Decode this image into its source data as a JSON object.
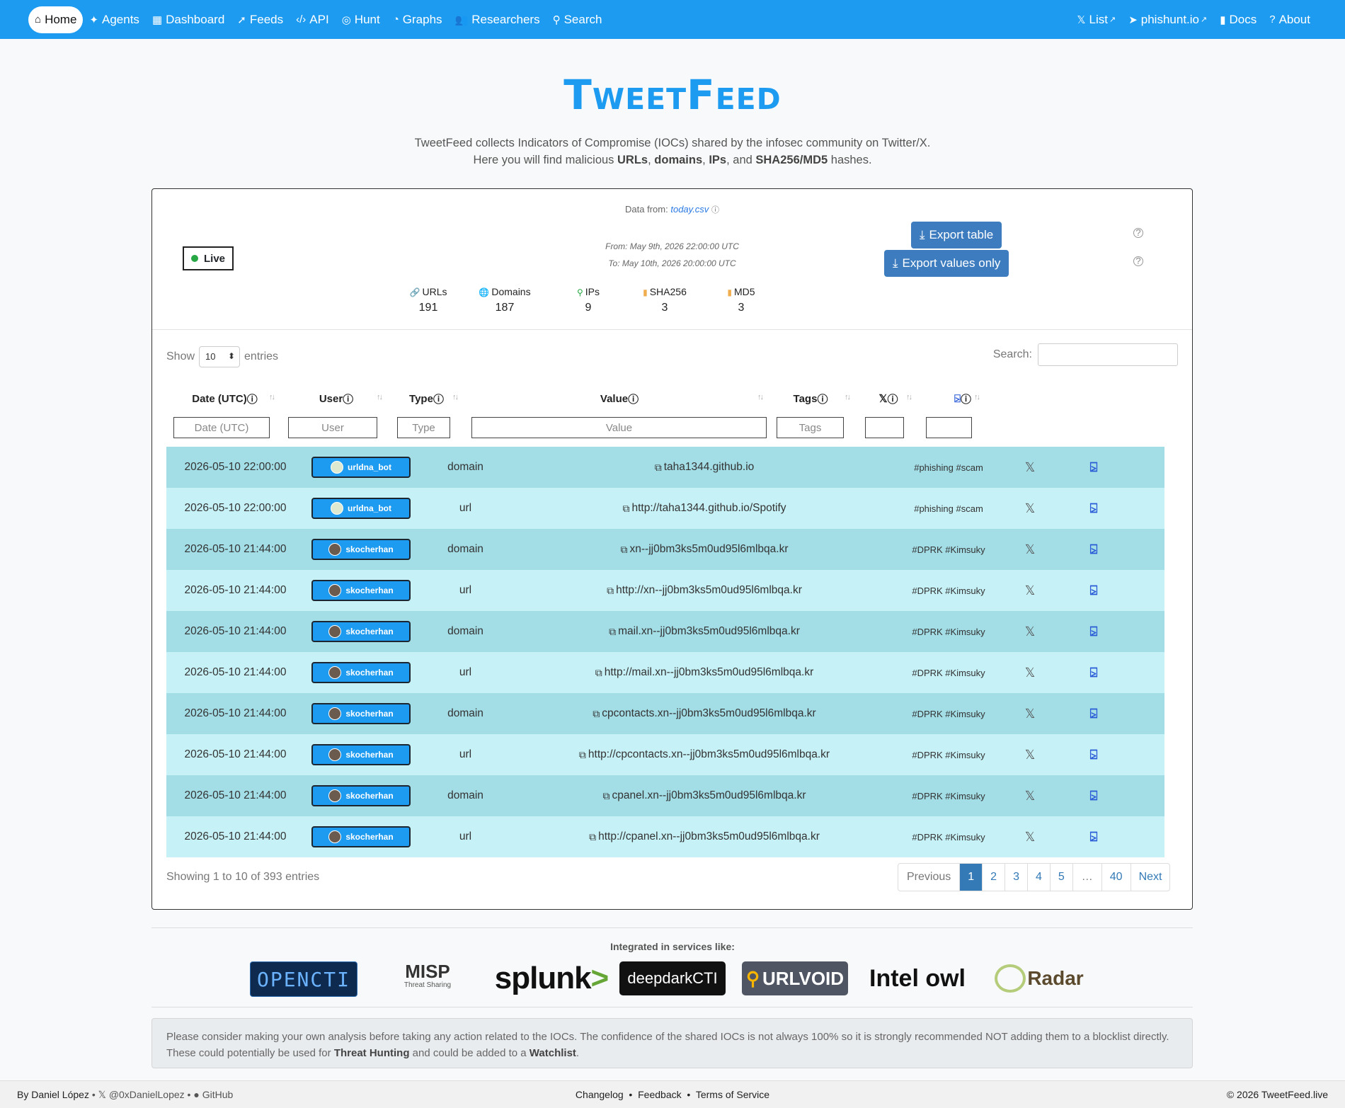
{
  "nav": {
    "left": [
      {
        "label": "Home",
        "icon": "home-icon",
        "glyph": "⌂",
        "active": true
      },
      {
        "label": "Agents",
        "icon": "sparkle-icon",
        "glyph": "✦"
      },
      {
        "label": "Dashboard",
        "icon": "grid-icon",
        "glyph": "▦"
      },
      {
        "label": "Feeds",
        "icon": "rss-icon",
        "glyph": "➚"
      },
      {
        "label": "API",
        "icon": "code-icon",
        "glyph": "‹/›"
      },
      {
        "label": "Hunt",
        "icon": "crosshair-icon",
        "glyph": "◎"
      },
      {
        "label": "Graphs",
        "icon": "pie-chart-icon",
        "glyph": "◔"
      },
      {
        "label": "Researchers",
        "icon": "users-icon",
        "glyph": "👥"
      },
      {
        "label": "Search",
        "icon": "search-icon",
        "glyph": "⚲"
      }
    ],
    "right": [
      {
        "label": "List",
        "icon": "x-logo-icon",
        "glyph": "𝕏",
        "external": true
      },
      {
        "label": "phishunt.io",
        "icon": "fish-icon",
        "glyph": "➤",
        "external": true
      },
      {
        "label": "Docs",
        "icon": "book-icon",
        "glyph": "▮"
      },
      {
        "label": "About",
        "icon": "question-circle-icon",
        "glyph": "?"
      }
    ]
  },
  "header": {
    "title": "TweetFeed",
    "intro_line1": "TweetFeed collects Indicators of Compromise (IOCs) shared by the infosec community on Twitter/X.",
    "intro_line2_pre": "Here you will find malicious ",
    "intro_urls": "URLs",
    "intro_sep1": ", ",
    "intro_domains": "domains",
    "intro_sep2": ", ",
    "intro_ips": "IPs",
    "intro_sep3": ", and ",
    "intro_hashes": "SHA256/MD5",
    "intro_post": " hashes."
  },
  "card": {
    "data_from_label": "Data from:",
    "data_from_file": "today.csv",
    "live_label": "Live",
    "range_from": "From: May 9th, 2026 22:00:00 UTC",
    "range_to": "To: May 10th, 2026 20:00:00 UTC",
    "export_table": "Export table",
    "export_values": "Export values only",
    "stats": [
      {
        "label": "URLs",
        "value": "191",
        "icon": "link-icon",
        "color": "#2a5bd7"
      },
      {
        "label": "Domains",
        "value": "187",
        "icon": "globe-icon",
        "color": "#2a7ae4"
      },
      {
        "label": "IPs",
        "value": "9",
        "icon": "map-pin-icon",
        "color": "#28a745"
      },
      {
        "label": "SHA256",
        "value": "3",
        "icon": "file-icon",
        "color": "#f0ad4e"
      },
      {
        "label": "MD5",
        "value": "3",
        "icon": "file-icon",
        "color": "#f0ad4e"
      }
    ]
  },
  "controls": {
    "show_label": "Show",
    "show_value": "10",
    "entries_label": "entries",
    "search_label": "Search:"
  },
  "table": {
    "headers": [
      "Date (UTC)",
      "User",
      "Type",
      "Value",
      "Tags",
      "",
      ""
    ],
    "filter_placeholders": [
      "Date (UTC)",
      "User",
      "Type",
      "Value",
      "Tags",
      "",
      ""
    ],
    "rows": [
      {
        "date": "2026-05-10 22:00:00",
        "user": "urldna_bot",
        "avatar": "ur",
        "type": "domain",
        "value": "taha1344.github.io",
        "tags": "#phishing #scam"
      },
      {
        "date": "2026-05-10 22:00:00",
        "user": "urldna_bot",
        "avatar": "ur",
        "type": "url",
        "value": "http://taha1344.github.io/Spotify",
        "tags": "#phishing #scam"
      },
      {
        "date": "2026-05-10 21:44:00",
        "user": "skocherhan",
        "avatar": "sk",
        "type": "domain",
        "value": "xn--jj0bm3ks5m0ud95l6mlbqa.kr",
        "tags": "#DPRK #Kimsuky"
      },
      {
        "date": "2026-05-10 21:44:00",
        "user": "skocherhan",
        "avatar": "sk",
        "type": "url",
        "value": "http://xn--jj0bm3ks5m0ud95l6mlbqa.kr",
        "tags": "#DPRK #Kimsuky"
      },
      {
        "date": "2026-05-10 21:44:00",
        "user": "skocherhan",
        "avatar": "sk",
        "type": "domain",
        "value": "mail.xn--jj0bm3ks5m0ud95l6mlbqa.kr",
        "tags": "#DPRK #Kimsuky"
      },
      {
        "date": "2026-05-10 21:44:00",
        "user": "skocherhan",
        "avatar": "sk",
        "type": "url",
        "value": "http://mail.xn--jj0bm3ks5m0ud95l6mlbqa.kr",
        "tags": "#DPRK #Kimsuky"
      },
      {
        "date": "2026-05-10 21:44:00",
        "user": "skocherhan",
        "avatar": "sk",
        "type": "domain",
        "value": "cpcontacts.xn--jj0bm3ks5m0ud95l6mlbqa.kr",
        "tags": "#DPRK #Kimsuky"
      },
      {
        "date": "2026-05-10 21:44:00",
        "user": "skocherhan",
        "avatar": "sk",
        "type": "url",
        "value": "http://cpcontacts.xn--jj0bm3ks5m0ud95l6mlbqa.kr",
        "tags": "#DPRK #Kimsuky"
      },
      {
        "date": "2026-05-10 21:44:00",
        "user": "skocherhan",
        "avatar": "sk",
        "type": "domain",
        "value": "cpanel.xn--jj0bm3ks5m0ud95l6mlbqa.kr",
        "tags": "#DPRK #Kimsuky"
      },
      {
        "date": "2026-05-10 21:44:00",
        "user": "skocherhan",
        "avatar": "sk",
        "type": "url",
        "value": "http://cpanel.xn--jj0bm3ks5m0ud95l6mlbqa.kr",
        "tags": "#DPRK #Kimsuky"
      }
    ],
    "showing": "Showing 1 to 10 of 393 entries",
    "pagination": [
      "Previous",
      "1",
      "2",
      "3",
      "4",
      "5",
      "…",
      "40",
      "Next"
    ],
    "current_page": "1"
  },
  "integrations": {
    "label": "Integrated in services like:",
    "logos": [
      "OPENCTI",
      "MISP",
      "splunk",
      "deepdarkCTI",
      "URLVOID",
      "Intel owl",
      "Radar"
    ]
  },
  "disclaimer": {
    "pre": "Please consider making your own analysis before taking any action related to the IOCs. The confidence of the shared IOCs is not always 100% so it is strongly recommended NOT adding them to a blocklist directly. These could potentially be used for ",
    "b1": "Threat Hunting",
    "mid": " and could be added to a ",
    "b2": "Watchlist",
    "post": "."
  },
  "footer": {
    "author": "By Daniel López",
    "x_handle": "@0xDanielLopez",
    "github": "GitHub",
    "changelog": "Changelog",
    "feedback": "Feedback",
    "terms": "Terms of Service",
    "copyright": "© 2026 TweetFeed.live"
  }
}
